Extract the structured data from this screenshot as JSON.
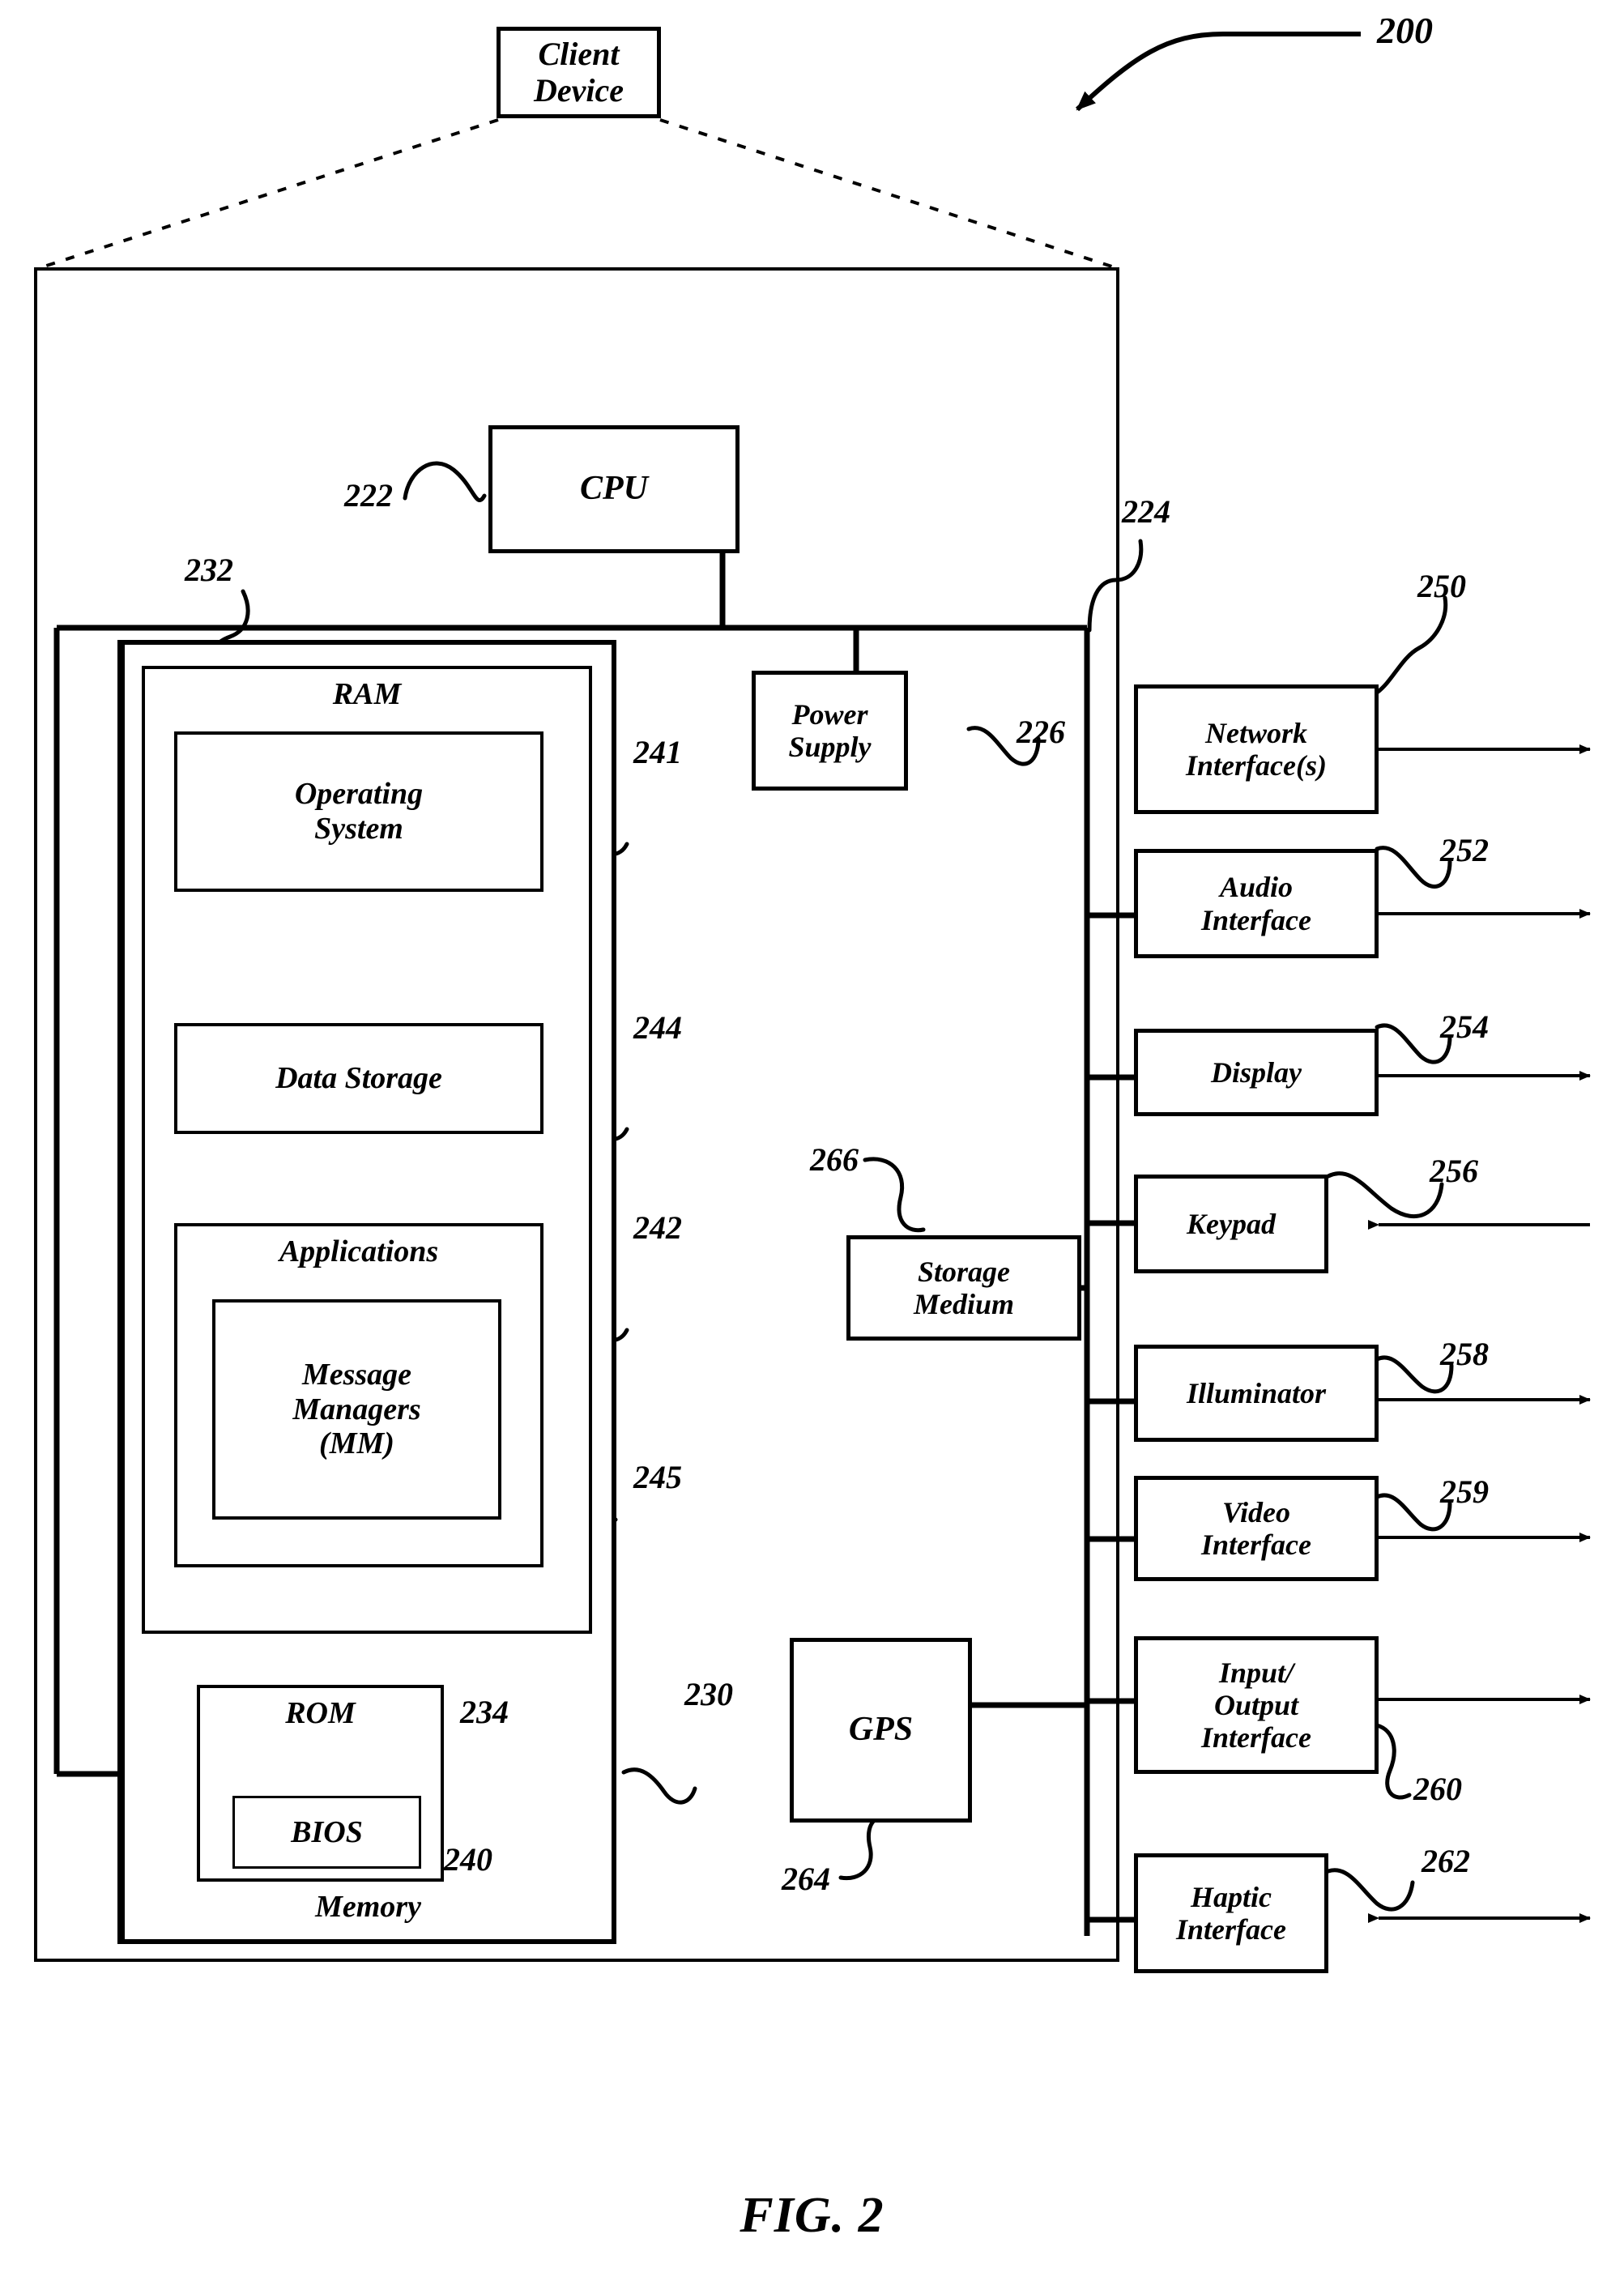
{
  "figure": {
    "caption": "FIG. 2",
    "top_reference": "200"
  },
  "client_device": {
    "label": "Client\nDevice"
  },
  "core": {
    "cpu": {
      "label": "CPU",
      "ref": "222"
    },
    "power_supply": {
      "label": "Power\nSupply",
      "ref": "226"
    },
    "bus": {
      "ref": "224"
    },
    "memory_bus": {
      "ref": "230"
    }
  },
  "memory": {
    "outer_label": "Memory",
    "outer_ref": "232",
    "ram": {
      "label": "RAM",
      "items": [
        {
          "label": "Operating\nSystem",
          "ref": "241"
        },
        {
          "label": "Data Storage",
          "ref": "244"
        },
        {
          "label": "Applications",
          "ref": "242"
        }
      ],
      "nested": {
        "label": "Message\nManagers\n(MM)",
        "ref": "245"
      }
    },
    "rom": {
      "label": "ROM",
      "ref": "234",
      "bios": {
        "label": "BIOS",
        "ref": "240"
      }
    }
  },
  "peripherals": {
    "storage_medium": {
      "label": "Storage\nMedium",
      "ref": "266"
    },
    "gps": {
      "label": "GPS",
      "ref": "264"
    },
    "interfaces": [
      {
        "label": "Network\nInterface(s)",
        "ref": "250",
        "arrow": "bidirectional"
      },
      {
        "label": "Audio\nInterface",
        "ref": "252",
        "arrow": "bidirectional"
      },
      {
        "label": "Display",
        "ref": "254",
        "arrow": "bidirectional"
      },
      {
        "label": "Keypad",
        "ref": "256",
        "arrow": "inbound"
      },
      {
        "label": "Illuminator",
        "ref": "258",
        "arrow": "outbound"
      },
      {
        "label": "Video\nInterface",
        "ref": "259",
        "arrow": "bidirectional"
      },
      {
        "label": "Input/\nOutput\nInterface",
        "ref": "260",
        "arrow": "bidirectional"
      },
      {
        "label": "Haptic\nInterface",
        "ref": "262",
        "arrow": "bidirectional"
      }
    ]
  },
  "colors": {
    "ink": "#000000",
    "paper": "#ffffff"
  }
}
